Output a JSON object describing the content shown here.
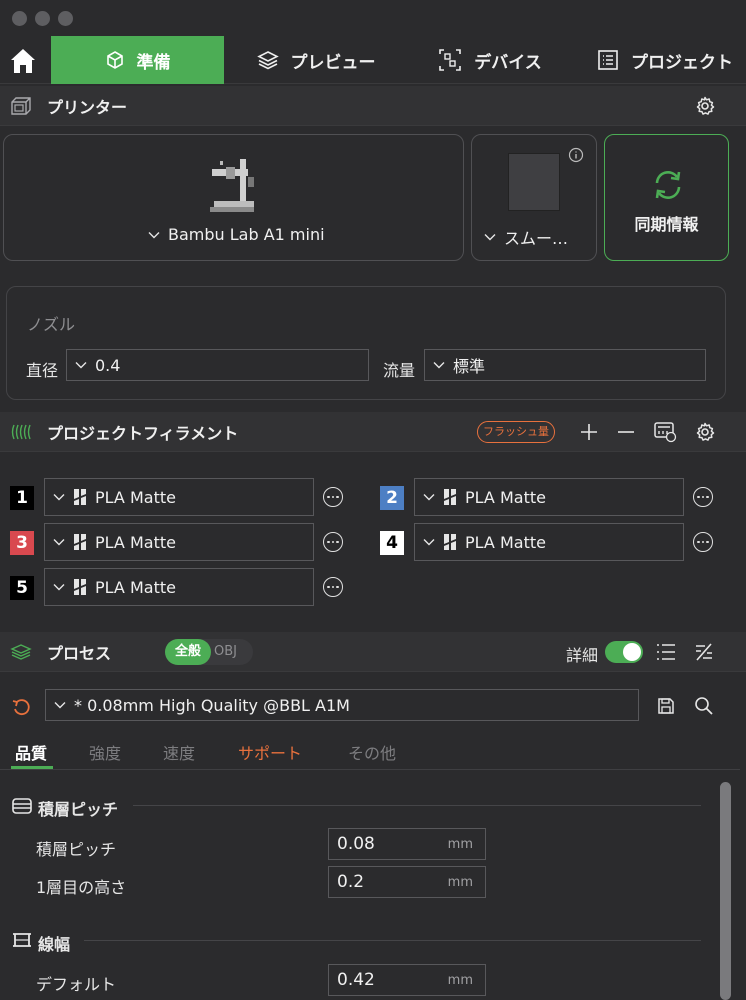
{
  "tabs": [
    {
      "label": "準備",
      "icon": "cube-icon",
      "active": true
    },
    {
      "label": "プレビュー",
      "icon": "layers-icon",
      "active": false
    },
    {
      "label": "デバイス",
      "icon": "device-icon",
      "active": false
    },
    {
      "label": "プロジェクト",
      "icon": "list-icon",
      "active": false
    }
  ],
  "printer": {
    "section_title": "プリンター",
    "printer_name": "Bambu Lab A1 mini",
    "plate_name": "スムー…",
    "sync_label": "同期情報"
  },
  "nozzle": {
    "title": "ノズル",
    "diameter_label": "直径",
    "diameter_value": "0.4",
    "flow_label": "流量",
    "flow_value": "標準"
  },
  "filament": {
    "section_title": "プロジェクトフィラメント",
    "flush_badge": "フラッシュ量",
    "items": [
      {
        "num": "1",
        "name": "PLA Matte",
        "color": "#000000"
      },
      {
        "num": "2",
        "name": "PLA Matte",
        "color": "#4d7fc4"
      },
      {
        "num": "3",
        "name": "PLA Matte",
        "color": "#d9494f"
      },
      {
        "num": "4",
        "name": "PLA Matte",
        "color": "#ffffff"
      },
      {
        "num": "5",
        "name": "PLA Matte",
        "color": "#000000"
      }
    ]
  },
  "process": {
    "section_title": "プロセス",
    "toggle_global": "全般",
    "toggle_obj": "OBJ",
    "detail_label": "詳細",
    "preset": "* 0.08mm High Quality @BBL A1M",
    "subtabs": [
      {
        "label": "品質",
        "state": "active"
      },
      {
        "label": "強度",
        "state": "normal"
      },
      {
        "label": "速度",
        "state": "normal"
      },
      {
        "label": "サポート",
        "state": "highlight"
      },
      {
        "label": "その他",
        "state": "normal"
      }
    ]
  },
  "params": {
    "group1_title": "積層ピッチ",
    "layer_height_label": "積層ピッチ",
    "layer_height_value": "0.08",
    "first_layer_label": "1層目の高さ",
    "first_layer_value": "0.2",
    "group2_title": "線幅",
    "default_label": "デフォルト",
    "default_value": "0.42",
    "unit": "mm"
  },
  "colors": {
    "accent": "#4cad55",
    "highlight": "#e8713d"
  }
}
